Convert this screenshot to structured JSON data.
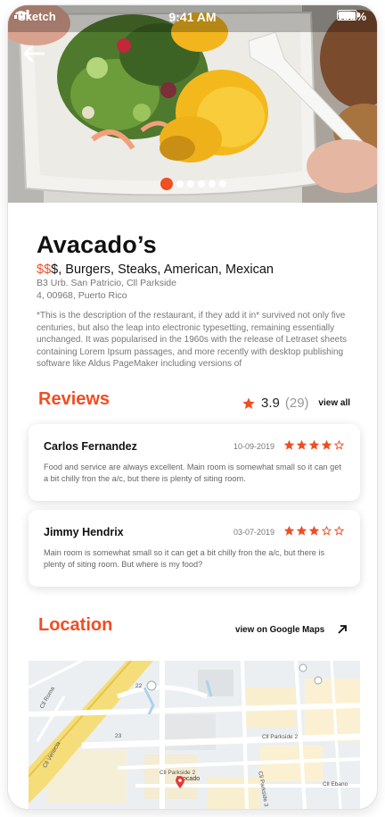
{
  "status_bar": {
    "carrier": "Sketch",
    "time": "9:41 AM",
    "battery": "100%"
  },
  "gallery": {
    "active_index": 0,
    "total": 6
  },
  "restaurant": {
    "name": "Avacado’s",
    "price_level_active": "$$",
    "price_level_rest": "$",
    "categories": ", Burgers, Steaks, American, Mexican",
    "address_line1": "B3 Urb. San Patricio, Cll Parkside",
    "address_line2": "4, 00968, Puerto Rico",
    "description": "*This is the description of the restaurant, if they add it in* survived not only five centuries, but also the leap into electronic typesetting, remaining essentially unchanged. It was popularised in the 1960s with the release of Letraset sheets containing Lorem Ipsum passages, and more recently with desktop publishing software like Aldus PageMaker including versions of"
  },
  "reviews": {
    "title": "Reviews",
    "rating": "3.9",
    "count": "(29)",
    "view_all": "view all",
    "items": [
      {
        "name": "Carlos Fernandez",
        "date": "10-09-2019",
        "stars": 4,
        "text": "Food and service are always excellent. Main room is somewhat small so it can get a bit chilly fron the a/c, but there is plenty of siting room."
      },
      {
        "name": "Jimmy Hendrix",
        "date": "03-07-2019",
        "stars": 3,
        "text": "Main room is somewhat small so it can get a bit chilly fron the a/c, but there is plenty of siting room. But where is my food?"
      }
    ]
  },
  "location": {
    "title": "Location",
    "maps_link": "view on Google Maps",
    "map_labels": {
      "venecia": "Cll Venecia",
      "roma": "Cll Roma",
      "route_23": "23",
      "route_22": "22",
      "parkside2_a": "Cll Parkside 2",
      "parkside2_b": "Cll Parkside 2",
      "parkside3": "Cll Parkside 3",
      "ebano": "Cll Ebano",
      "pin_name": "Avocado"
    }
  },
  "colors": {
    "accent": "#f04e23",
    "star_empty_stroke": "#f04e23"
  }
}
